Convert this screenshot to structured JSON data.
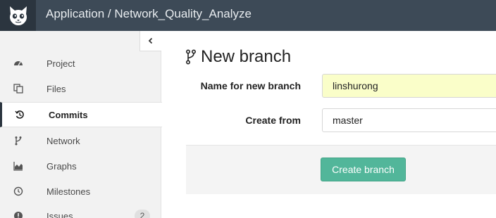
{
  "header": {
    "title": "Application / Network_Quality_Analyze"
  },
  "sidebar": {
    "collapse_icon": "chevron-left-icon",
    "items": [
      {
        "label": "Project",
        "icon": "dashboard-icon",
        "active": false
      },
      {
        "label": "Files",
        "icon": "files-icon",
        "active": false
      },
      {
        "label": "Commits",
        "icon": "history-icon",
        "active": true
      },
      {
        "label": "Network",
        "icon": "code-fork-icon",
        "active": false
      },
      {
        "label": "Graphs",
        "icon": "area-chart-icon",
        "active": false
      },
      {
        "label": "Milestones",
        "icon": "clock-icon",
        "active": false
      },
      {
        "label": "Issues",
        "icon": "exclamation-circle-icon",
        "active": false,
        "badge": "2"
      }
    ]
  },
  "main": {
    "title": "New branch",
    "title_icon": "code-fork-icon",
    "form": {
      "branch_name_label": "Name for new branch",
      "branch_name_value": "linshurong",
      "create_from_label": "Create from",
      "create_from_value": "master",
      "submit_label": "Create branch"
    }
  },
  "colors": {
    "header_bg": "#3d4a57",
    "logo_bg": "#2b353f",
    "sidebar_bg": "#f2f2f2",
    "input_highlight": "#fafec9",
    "button_accent": "#52b69a"
  }
}
